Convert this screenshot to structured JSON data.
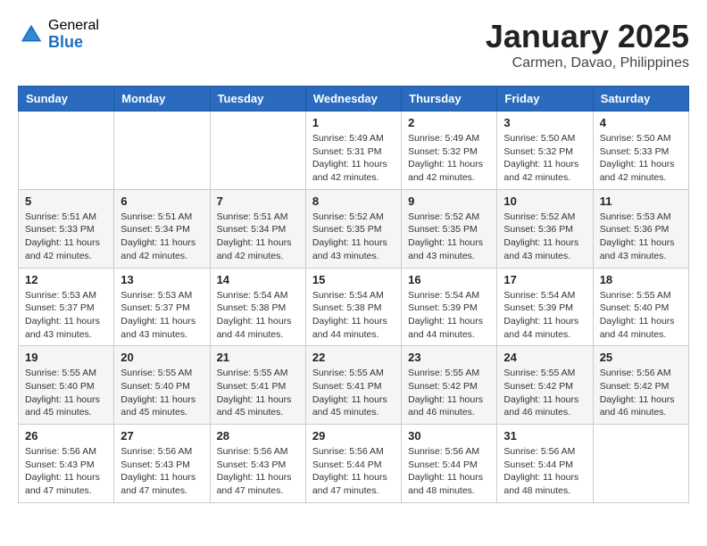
{
  "header": {
    "logo_general": "General",
    "logo_blue": "Blue",
    "month_title": "January 2025",
    "location": "Carmen, Davao, Philippines"
  },
  "calendar": {
    "weekdays": [
      "Sunday",
      "Monday",
      "Tuesday",
      "Wednesday",
      "Thursday",
      "Friday",
      "Saturday"
    ],
    "weeks": [
      [
        {
          "day": "",
          "sunrise": "",
          "sunset": "",
          "daylight": ""
        },
        {
          "day": "",
          "sunrise": "",
          "sunset": "",
          "daylight": ""
        },
        {
          "day": "",
          "sunrise": "",
          "sunset": "",
          "daylight": ""
        },
        {
          "day": "1",
          "sunrise": "Sunrise: 5:49 AM",
          "sunset": "Sunset: 5:31 PM",
          "daylight": "Daylight: 11 hours and 42 minutes."
        },
        {
          "day": "2",
          "sunrise": "Sunrise: 5:49 AM",
          "sunset": "Sunset: 5:32 PM",
          "daylight": "Daylight: 11 hours and 42 minutes."
        },
        {
          "day": "3",
          "sunrise": "Sunrise: 5:50 AM",
          "sunset": "Sunset: 5:32 PM",
          "daylight": "Daylight: 11 hours and 42 minutes."
        },
        {
          "day": "4",
          "sunrise": "Sunrise: 5:50 AM",
          "sunset": "Sunset: 5:33 PM",
          "daylight": "Daylight: 11 hours and 42 minutes."
        }
      ],
      [
        {
          "day": "5",
          "sunrise": "Sunrise: 5:51 AM",
          "sunset": "Sunset: 5:33 PM",
          "daylight": "Daylight: 11 hours and 42 minutes."
        },
        {
          "day": "6",
          "sunrise": "Sunrise: 5:51 AM",
          "sunset": "Sunset: 5:34 PM",
          "daylight": "Daylight: 11 hours and 42 minutes."
        },
        {
          "day": "7",
          "sunrise": "Sunrise: 5:51 AM",
          "sunset": "Sunset: 5:34 PM",
          "daylight": "Daylight: 11 hours and 42 minutes."
        },
        {
          "day": "8",
          "sunrise": "Sunrise: 5:52 AM",
          "sunset": "Sunset: 5:35 PM",
          "daylight": "Daylight: 11 hours and 43 minutes."
        },
        {
          "day": "9",
          "sunrise": "Sunrise: 5:52 AM",
          "sunset": "Sunset: 5:35 PM",
          "daylight": "Daylight: 11 hours and 43 minutes."
        },
        {
          "day": "10",
          "sunrise": "Sunrise: 5:52 AM",
          "sunset": "Sunset: 5:36 PM",
          "daylight": "Daylight: 11 hours and 43 minutes."
        },
        {
          "day": "11",
          "sunrise": "Sunrise: 5:53 AM",
          "sunset": "Sunset: 5:36 PM",
          "daylight": "Daylight: 11 hours and 43 minutes."
        }
      ],
      [
        {
          "day": "12",
          "sunrise": "Sunrise: 5:53 AM",
          "sunset": "Sunset: 5:37 PM",
          "daylight": "Daylight: 11 hours and 43 minutes."
        },
        {
          "day": "13",
          "sunrise": "Sunrise: 5:53 AM",
          "sunset": "Sunset: 5:37 PM",
          "daylight": "Daylight: 11 hours and 43 minutes."
        },
        {
          "day": "14",
          "sunrise": "Sunrise: 5:54 AM",
          "sunset": "Sunset: 5:38 PM",
          "daylight": "Daylight: 11 hours and 44 minutes."
        },
        {
          "day": "15",
          "sunrise": "Sunrise: 5:54 AM",
          "sunset": "Sunset: 5:38 PM",
          "daylight": "Daylight: 11 hours and 44 minutes."
        },
        {
          "day": "16",
          "sunrise": "Sunrise: 5:54 AM",
          "sunset": "Sunset: 5:39 PM",
          "daylight": "Daylight: 11 hours and 44 minutes."
        },
        {
          "day": "17",
          "sunrise": "Sunrise: 5:54 AM",
          "sunset": "Sunset: 5:39 PM",
          "daylight": "Daylight: 11 hours and 44 minutes."
        },
        {
          "day": "18",
          "sunrise": "Sunrise: 5:55 AM",
          "sunset": "Sunset: 5:40 PM",
          "daylight": "Daylight: 11 hours and 44 minutes."
        }
      ],
      [
        {
          "day": "19",
          "sunrise": "Sunrise: 5:55 AM",
          "sunset": "Sunset: 5:40 PM",
          "daylight": "Daylight: 11 hours and 45 minutes."
        },
        {
          "day": "20",
          "sunrise": "Sunrise: 5:55 AM",
          "sunset": "Sunset: 5:40 PM",
          "daylight": "Daylight: 11 hours and 45 minutes."
        },
        {
          "day": "21",
          "sunrise": "Sunrise: 5:55 AM",
          "sunset": "Sunset: 5:41 PM",
          "daylight": "Daylight: 11 hours and 45 minutes."
        },
        {
          "day": "22",
          "sunrise": "Sunrise: 5:55 AM",
          "sunset": "Sunset: 5:41 PM",
          "daylight": "Daylight: 11 hours and 45 minutes."
        },
        {
          "day": "23",
          "sunrise": "Sunrise: 5:55 AM",
          "sunset": "Sunset: 5:42 PM",
          "daylight": "Daylight: 11 hours and 46 minutes."
        },
        {
          "day": "24",
          "sunrise": "Sunrise: 5:55 AM",
          "sunset": "Sunset: 5:42 PM",
          "daylight": "Daylight: 11 hours and 46 minutes."
        },
        {
          "day": "25",
          "sunrise": "Sunrise: 5:56 AM",
          "sunset": "Sunset: 5:42 PM",
          "daylight": "Daylight: 11 hours and 46 minutes."
        }
      ],
      [
        {
          "day": "26",
          "sunrise": "Sunrise: 5:56 AM",
          "sunset": "Sunset: 5:43 PM",
          "daylight": "Daylight: 11 hours and 47 minutes."
        },
        {
          "day": "27",
          "sunrise": "Sunrise: 5:56 AM",
          "sunset": "Sunset: 5:43 PM",
          "daylight": "Daylight: 11 hours and 47 minutes."
        },
        {
          "day": "28",
          "sunrise": "Sunrise: 5:56 AM",
          "sunset": "Sunset: 5:43 PM",
          "daylight": "Daylight: 11 hours and 47 minutes."
        },
        {
          "day": "29",
          "sunrise": "Sunrise: 5:56 AM",
          "sunset": "Sunset: 5:44 PM",
          "daylight": "Daylight: 11 hours and 47 minutes."
        },
        {
          "day": "30",
          "sunrise": "Sunrise: 5:56 AM",
          "sunset": "Sunset: 5:44 PM",
          "daylight": "Daylight: 11 hours and 48 minutes."
        },
        {
          "day": "31",
          "sunrise": "Sunrise: 5:56 AM",
          "sunset": "Sunset: 5:44 PM",
          "daylight": "Daylight: 11 hours and 48 minutes."
        },
        {
          "day": "",
          "sunrise": "",
          "sunset": "",
          "daylight": ""
        }
      ]
    ]
  }
}
